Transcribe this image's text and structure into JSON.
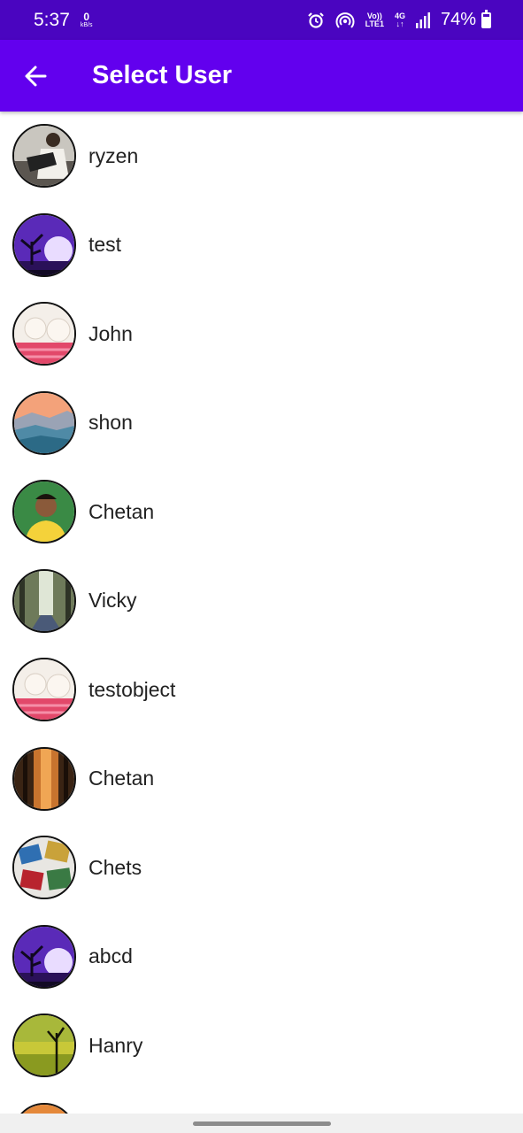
{
  "status_bar": {
    "time": "5:37",
    "net_speed_value": "0",
    "net_speed_unit": "kB/s",
    "volte_line1": "Vo))",
    "volte_line2": "LTE1",
    "network_type": "4G",
    "network_arrows": "↓↑",
    "battery_percent": "74%",
    "battery_level": 0.74,
    "icons": [
      "alarm-icon",
      "hotspot-icon",
      "signal-icon",
      "battery-icon"
    ]
  },
  "app_bar": {
    "title": "Select User",
    "color": "#6200ee",
    "status_color": "#4a05c0"
  },
  "users": [
    {
      "name": "ryzen",
      "avatar": "person-photo"
    },
    {
      "name": "test",
      "avatar": "purple-night-tree-photo"
    },
    {
      "name": "John",
      "avatar": "kitten-photo"
    },
    {
      "name": "shon",
      "avatar": "mountain-sunset-photo"
    },
    {
      "name": "Chetan",
      "avatar": "person-portrait-photo"
    },
    {
      "name": "Vicky",
      "avatar": "forest-path-photo"
    },
    {
      "name": "testobject",
      "avatar": "kitten-photo"
    },
    {
      "name": "Chetan",
      "avatar": "autumn-forest-photo"
    },
    {
      "name": "Chets",
      "avatar": "photo-collage"
    },
    {
      "name": "abcd",
      "avatar": "purple-night-tree-photo"
    },
    {
      "name": "Hanry",
      "avatar": "yellow-field-tree-photo"
    },
    {
      "name": "",
      "avatar": "orange-photo-partial"
    }
  ]
}
